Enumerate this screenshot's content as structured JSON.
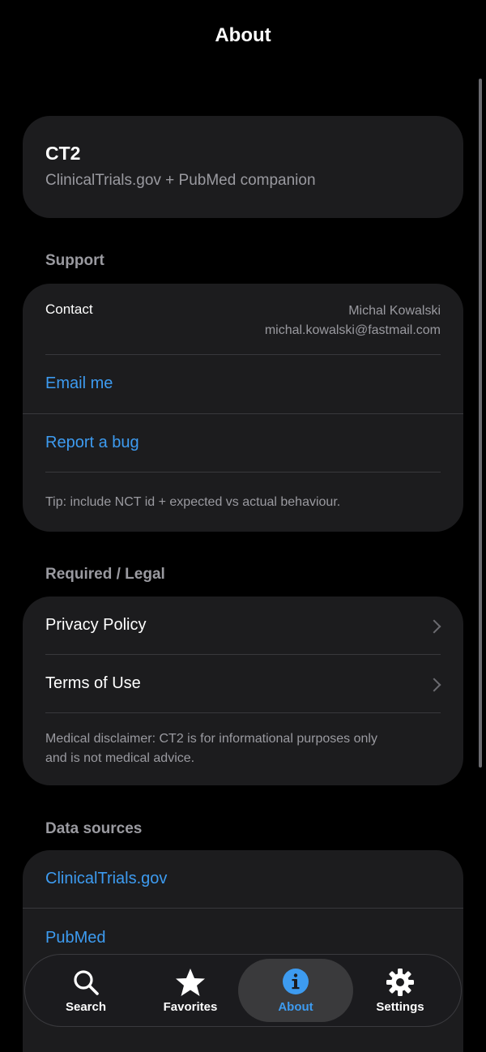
{
  "nav": {
    "title": "About"
  },
  "app": {
    "name": "CT2",
    "tagline": "ClinicalTrials.gov + PubMed companion"
  },
  "support": {
    "header": "Support",
    "contact_label": "Contact",
    "contact_name": "Michal Kowalski",
    "contact_email": "michal.kowalski@fastmail.com",
    "email_me": "Email me",
    "report_bug": "Report a bug",
    "tip": "Tip: include NCT id + expected vs actual behaviour."
  },
  "legal": {
    "header": "Required / Legal",
    "privacy": "Privacy Policy",
    "terms": "Terms of Use",
    "disclaimer_line1": "Medical disclaimer: CT2 is for informational purposes only",
    "disclaimer_line2": "and is not medical advice."
  },
  "data_sources": {
    "header": "Data sources",
    "items": [
      "ClinicalTrials.gov",
      "PubMed"
    ]
  },
  "tabbar": {
    "tabs": [
      {
        "label": "Search",
        "icon": "search-icon"
      },
      {
        "label": "Favorites",
        "icon": "star-icon"
      },
      {
        "label": "About",
        "icon": "info-icon",
        "active": true
      },
      {
        "label": "Settings",
        "icon": "gear-icon"
      }
    ]
  },
  "colors": {
    "accent": "#3d9bf0",
    "card": "#1c1c1e",
    "background": "#000000",
    "secondary_text": "#9a9aa0"
  }
}
